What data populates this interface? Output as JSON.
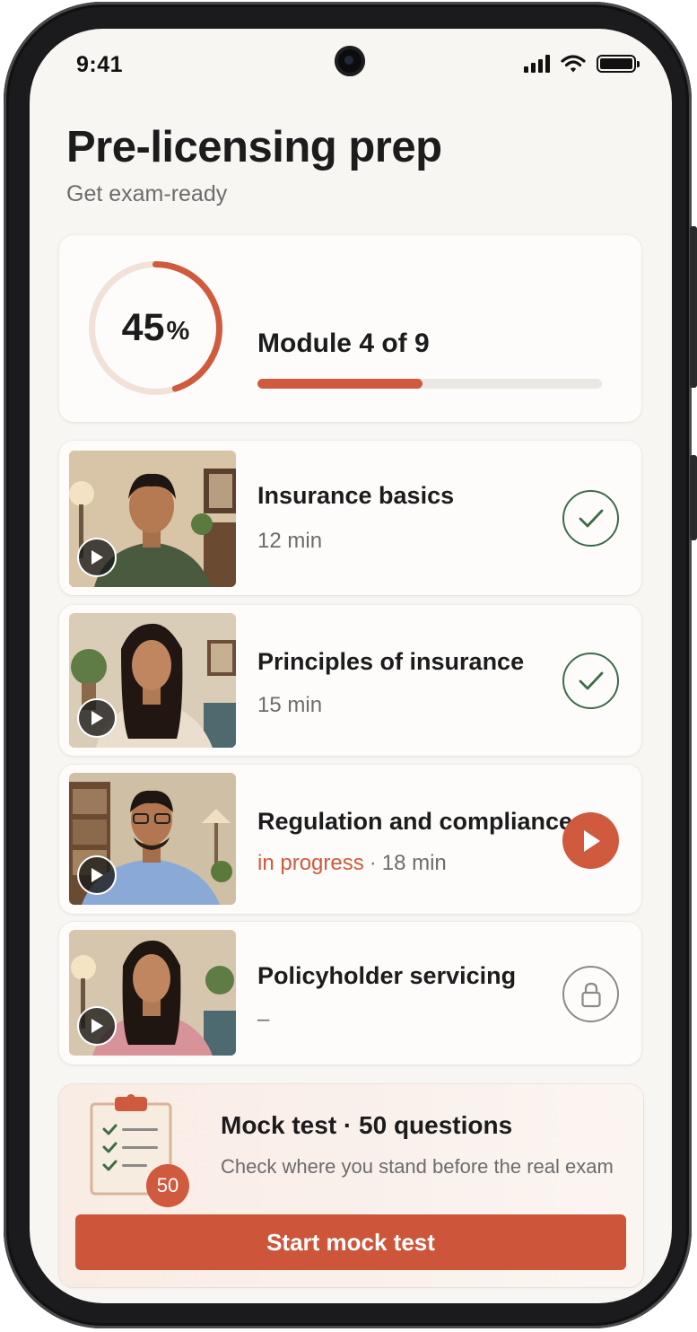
{
  "status_bar": {
    "time": "9:41"
  },
  "header": {
    "title": "Pre-licensing prep",
    "subtitle": "Get exam-ready"
  },
  "progress": {
    "percent_value": "45",
    "percent_sign": "%",
    "percent": 45,
    "module_label": "Module 4 of 9",
    "module_bar_fraction": 0.48
  },
  "lessons": [
    {
      "title": "Insurance basics",
      "duration": "12 min",
      "status": "completed",
      "status_icon": "check-icon"
    },
    {
      "title": "Principles of insurance",
      "duration": "15 min",
      "status": "completed",
      "status_icon": "check-icon"
    },
    {
      "title": "Regulation and compliance",
      "progress_label": "in progress",
      "separator": "·",
      "duration": "18 min",
      "status": "in-progress",
      "status_icon": "play-icon"
    },
    {
      "title": "Policyholder servicing",
      "duration": "–",
      "status": "locked",
      "status_icon": "lock-icon"
    }
  ],
  "mock_test": {
    "title": "Mock test · 50 questions",
    "subtitle": "Check where you stand before the real exam",
    "badge": "50",
    "button_label": "Start mock test"
  },
  "colors": {
    "accent": "#d05a3e",
    "done_green": "#3f6b4b",
    "background": "#f8f6f2"
  }
}
